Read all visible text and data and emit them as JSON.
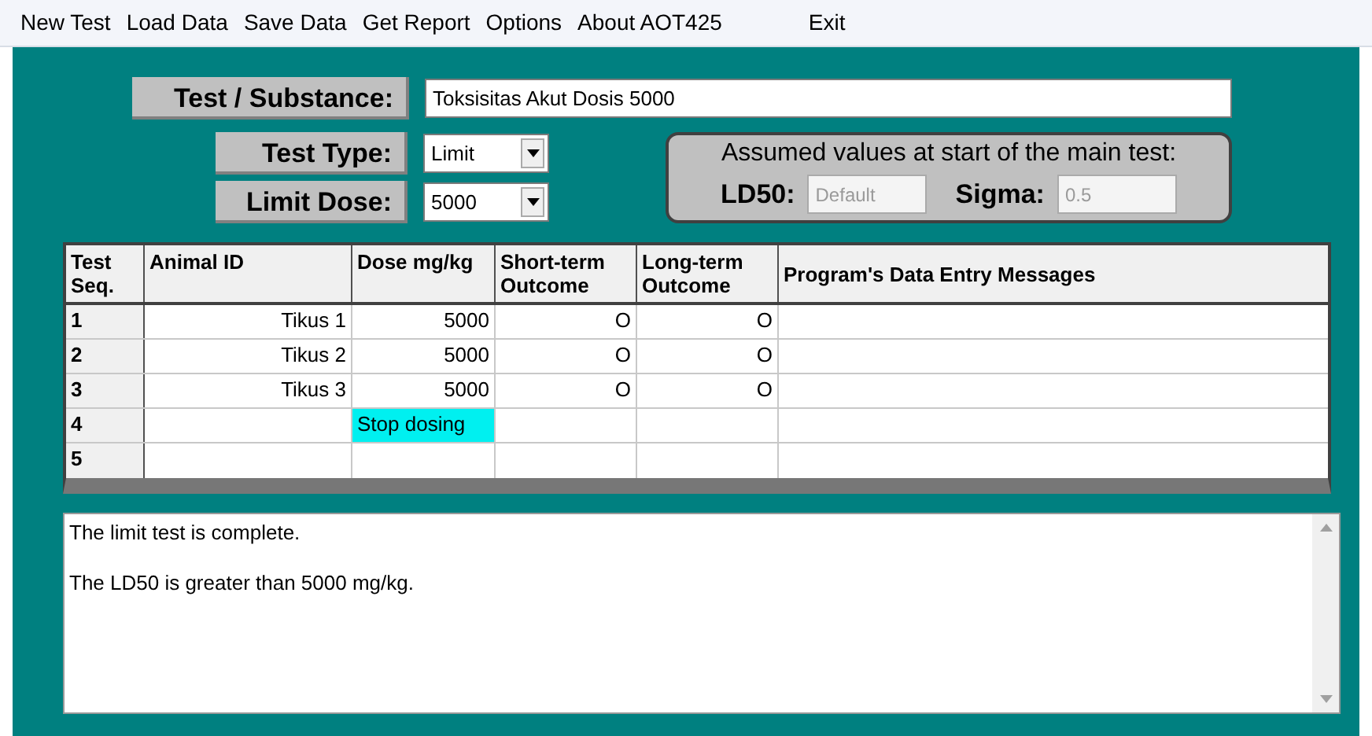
{
  "menu": [
    "New Test",
    "Load Data",
    "Save Data",
    "Get Report",
    "Options",
    "About AOT425",
    "Exit"
  ],
  "substance": {
    "label": "Test / Substance:",
    "value": "Toksisitas Akut Dosis 5000"
  },
  "test_type": {
    "label": "Test Type:",
    "value": "Limit"
  },
  "limit_dose": {
    "label": "Limit Dose:",
    "value": "5000"
  },
  "assumed": {
    "title": "Assumed values at start of the main test:",
    "ld50": {
      "label": "LD50:",
      "value": "Default",
      "disabled": true
    },
    "sigma": {
      "label": "Sigma:",
      "value": "0.5",
      "disabled": true
    }
  },
  "table": {
    "columns": [
      "Test Seq.",
      "Animal ID",
      "Dose mg/kg",
      "Short-term Outcome",
      "Long-term Outcome",
      "Program's Data Entry Messages"
    ],
    "rows": [
      {
        "seq": "1",
        "animal_id": "Tikus 1",
        "dose": "5000",
        "short_term": "O",
        "long_term": "O",
        "dose_highlighted": false
      },
      {
        "seq": "2",
        "animal_id": "Tikus 2",
        "dose": "5000",
        "short_term": "O",
        "long_term": "O",
        "dose_highlighted": false
      },
      {
        "seq": "3",
        "animal_id": "Tikus 3",
        "dose": "5000",
        "short_term": "O",
        "long_term": "O",
        "dose_highlighted": false
      },
      {
        "seq": "4",
        "dose": "Stop dosing",
        "dose_highlighted": true
      },
      {
        "seq": "5",
        "dose_highlighted": false
      }
    ]
  },
  "output": [
    "The limit test is complete.",
    "The LD50 is greater than 5000 mg/kg."
  ]
}
